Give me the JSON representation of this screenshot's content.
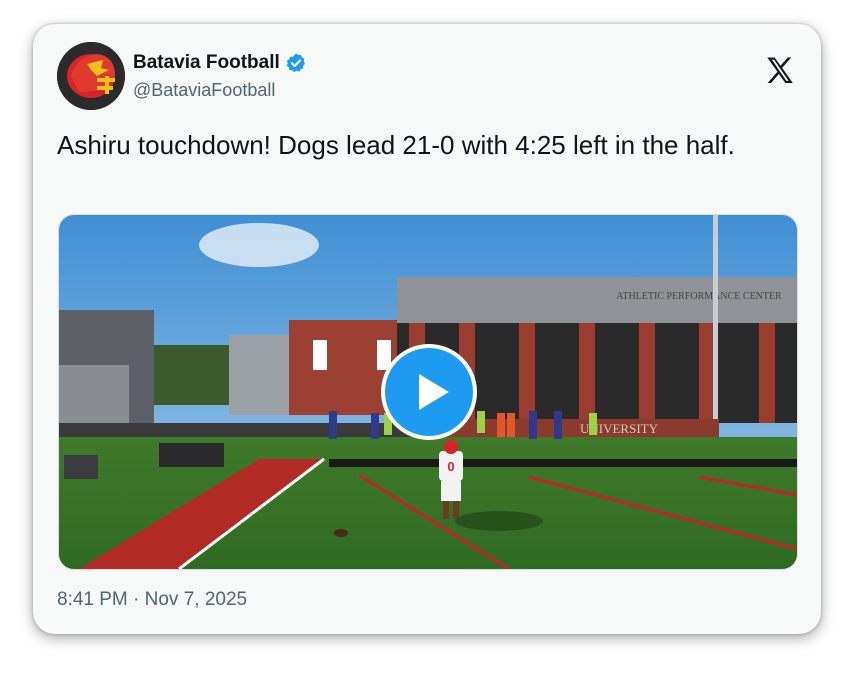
{
  "account": {
    "name": "Batavia Football",
    "handle": "@BataviaFootball"
  },
  "tweet": {
    "text": "Ashiru touchdown! Dogs lead 21-0 with 4:25 left in the half.",
    "timestamp": "8:41 PM · Nov 7, 2025"
  },
  "media": {
    "building_sign": "ATHLETIC PERFORMANCE CENTER",
    "wall_sign": "UNIVERSITY",
    "player_number": "0"
  },
  "colors": {
    "accent": "#1d9bf0",
    "text": "#0f1419",
    "muted": "#536471"
  },
  "icons": {
    "verified": "verified-badge-icon",
    "platform": "x-logo-icon",
    "play": "play-icon"
  }
}
